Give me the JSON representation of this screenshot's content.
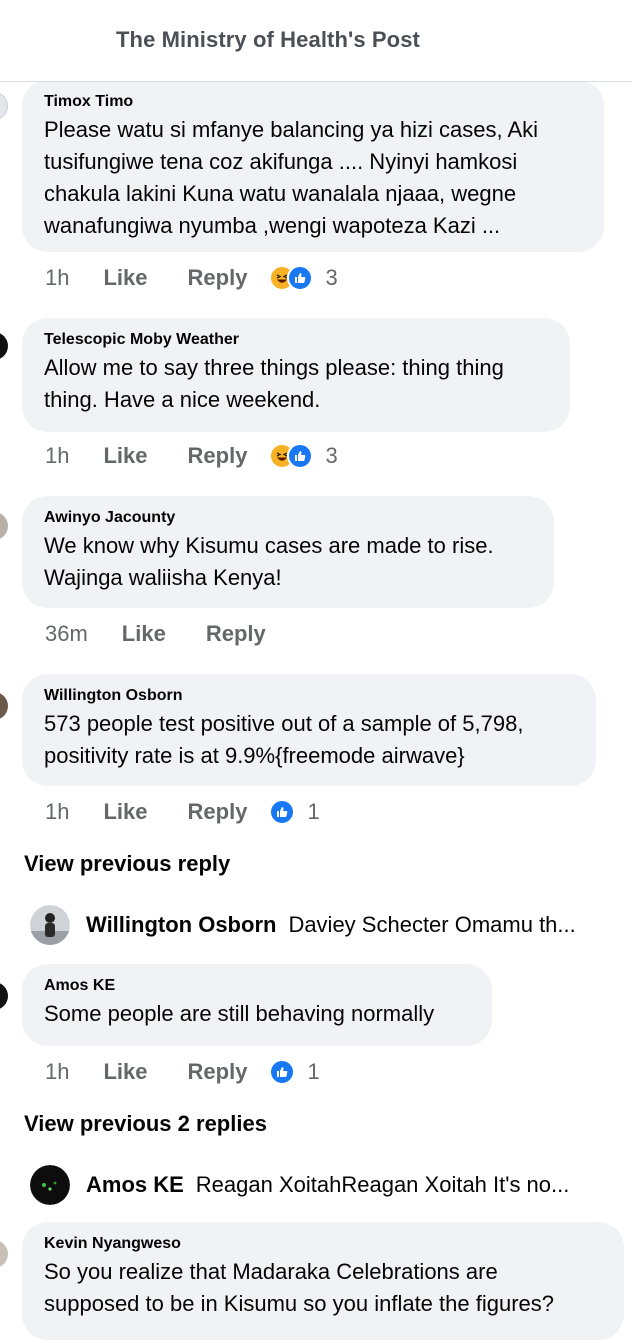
{
  "header": {
    "title": "The Ministry of Health's Post"
  },
  "comments": [
    {
      "author": "Timox Timo",
      "text": "Please watu si mfanye balancing ya hizi cases, Aki\ntusifungiwe tena coz akifunga .... Nyinyi hamkosi\nchakula lakini Kuna watu wanalala njaaa, wegne\nwanafungiwa nyumba ,wengi wapoteza Kazi ...",
      "time": "1h",
      "like": "Like",
      "reply": "Reply",
      "reaction_count": "3",
      "reactions": [
        "haha-icon",
        "like-icon"
      ]
    },
    {
      "author": "Telescopic Moby Weather",
      "text": "Allow me to say three things please: thing thing\nthing. Have a nice weekend.",
      "time": "1h",
      "like": "Like",
      "reply": "Reply",
      "reaction_count": "3",
      "reactions": [
        "haha-icon",
        "like-icon"
      ]
    },
    {
      "author": "Awinyo Jacounty",
      "text": "We know why Kisumu cases are made to rise.\nWajinga waliisha Kenya!",
      "time": "36m",
      "like": "Like",
      "reply": "Reply"
    },
    {
      "author": "Willington Osborn",
      "text": "573 people test  positive out of a sample of 5,798,\npositivity rate is at 9.9%{freemode airwave}",
      "time": "1h",
      "like": "Like",
      "reply": "Reply",
      "reaction_count": "1",
      "reactions": [
        "like-icon"
      ]
    },
    {
      "author": "Amos KE",
      "text": "Some people are still behaving normally",
      "time": "1h",
      "like": "Like",
      "reply": "Reply",
      "reaction_count": "1",
      "reactions": [
        "like-icon"
      ]
    },
    {
      "author": "Kevin Nyangweso",
      "text": "So you realize that Madaraka Celebrations are\nsupposed to be in Kisumu so you inflate the figures?"
    }
  ],
  "view_previous": [
    {
      "label": "View previous reply"
    },
    {
      "label": "View previous 2 replies"
    }
  ],
  "reply_previews": [
    {
      "author": "Willington Osborn",
      "text": "Daviey Schecter Omamu th..."
    },
    {
      "author": "Amos KE",
      "text": "Reagan XoitahReagan Xoitah It's no..."
    }
  ],
  "colors": {
    "bubble": "#f0f2f5",
    "meta": "#65676b",
    "like_blue": "#1877f2",
    "haha_yellow": "#f7b125"
  }
}
